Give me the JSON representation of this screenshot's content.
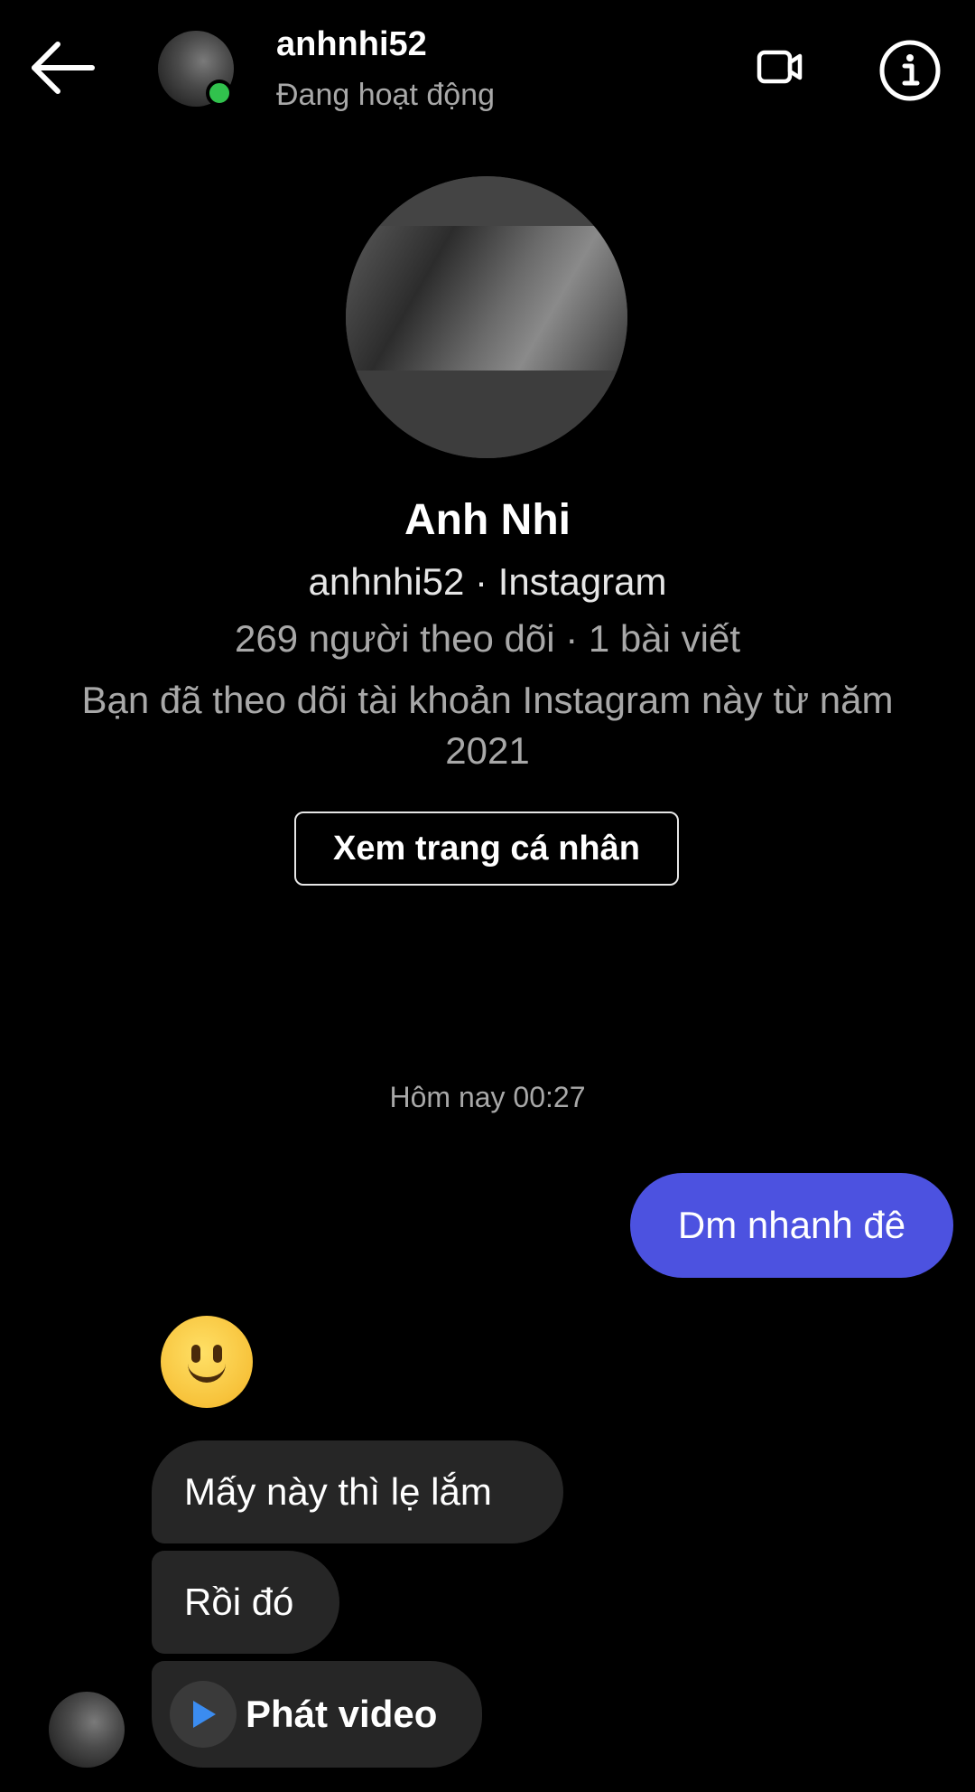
{
  "header": {
    "username": "anhnhi52",
    "status": "Đang hoạt động"
  },
  "profile": {
    "name": "Anh Nhi",
    "handle": "anhnhi52 · Instagram",
    "stats": "269 người theo dõi · 1 bài viết",
    "follow_note": "Bạn đã theo dõi tài khoản Instagram này từ năm 2021",
    "view_profile_label": "Xem trang cá nhân"
  },
  "chat": {
    "timestamp": "Hôm nay 00:27",
    "messages": [
      {
        "direction": "sent",
        "text": "Dm nhanh đê"
      },
      {
        "direction": "received",
        "emoji": "slightly-smiling-face"
      },
      {
        "direction": "received",
        "text": "Mấy này thì lẹ lắm"
      },
      {
        "direction": "received",
        "text": "Rồi đó"
      },
      {
        "direction": "received",
        "text": "Phát video"
      }
    ]
  },
  "colors": {
    "background": "#000000",
    "sent_bubble": "#4c52e0",
    "received_bubble": "#262626",
    "online_dot": "#31c24d",
    "secondary_text": "#a8a8a8"
  }
}
